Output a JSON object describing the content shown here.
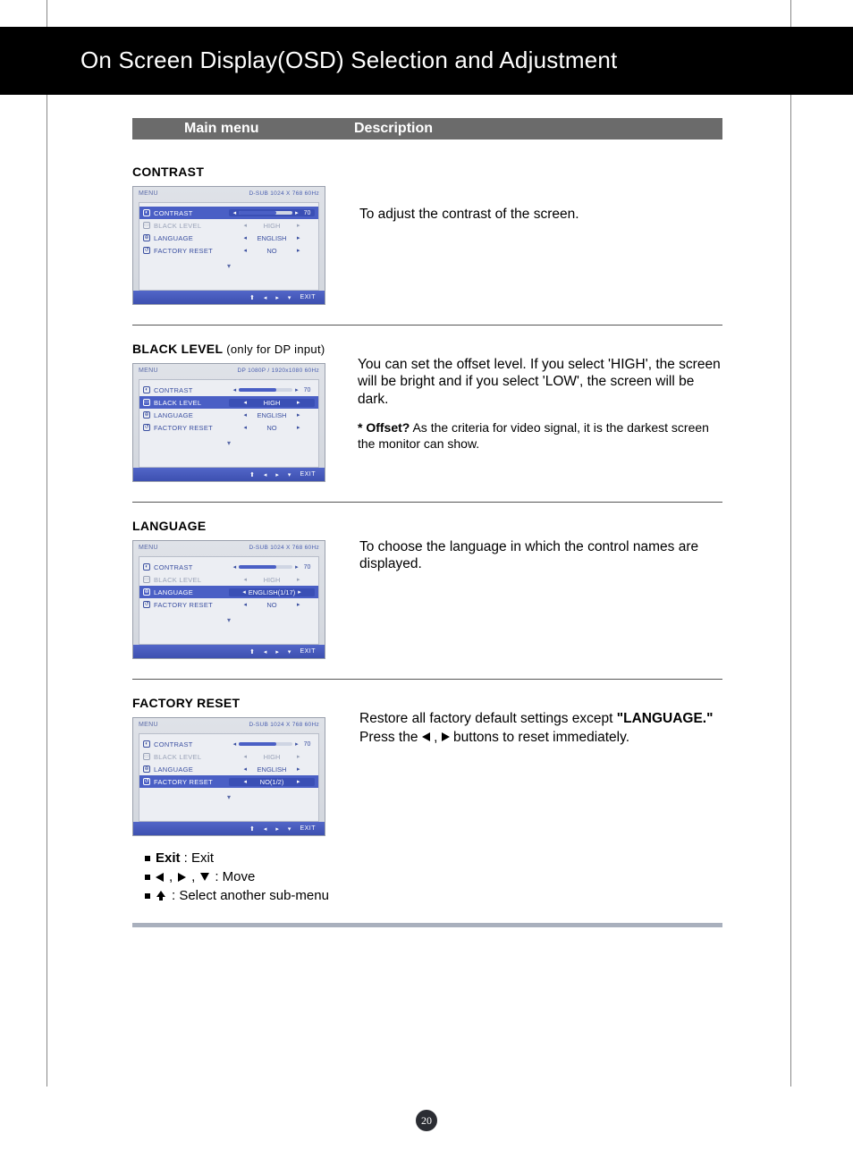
{
  "page": {
    "title": "On Screen Display(OSD) Selection and Adjustment",
    "columns": {
      "main_menu": "Main menu",
      "description": "Description"
    },
    "number": "20"
  },
  "sections": {
    "contrast": {
      "heading": "CONTRAST",
      "description": "To adjust the contrast of the screen.",
      "osd": {
        "menu_label": "MENU",
        "signal": "D-SUB 1024 X 768 60Hz",
        "rows": {
          "contrast": {
            "label": "CONTRAST",
            "value": "70",
            "selected": true,
            "slider": true
          },
          "black_level": {
            "label": "BLACK LEVEL",
            "value": "HIGH",
            "dim": true
          },
          "language": {
            "label": "LANGUAGE",
            "value": "ENGLISH"
          },
          "factory_reset": {
            "label": "FACTORY RESET",
            "value": "NO"
          }
        },
        "exit": "EXIT"
      }
    },
    "black_level": {
      "heading": "BLACK LEVEL",
      "qualifier": "(only for DP input)",
      "description": "You can set the offset level. If you select 'HIGH', the screen will be bright and if you select 'LOW', the screen will be dark.",
      "offset_label": "* Offset?",
      "offset_text": " As the criteria for video signal, it is the darkest screen the monitor can show.",
      "osd": {
        "menu_label": "MENU",
        "signal": "DP 1080P / 1920x1080 60Hz",
        "rows": {
          "contrast": {
            "label": "CONTRAST",
            "value": "70",
            "slider": true
          },
          "black_level": {
            "label": "BLACK LEVEL",
            "value": "HIGH",
            "selected": true
          },
          "language": {
            "label": "LANGUAGE",
            "value": "ENGLISH"
          },
          "factory_reset": {
            "label": "FACTORY RESET",
            "value": "NO"
          }
        },
        "exit": "EXIT"
      }
    },
    "language": {
      "heading": "LANGUAGE",
      "description": "To choose the language in which the control names are displayed.",
      "osd": {
        "menu_label": "MENU",
        "signal": "D-SUB 1024 X 768 60Hz",
        "rows": {
          "contrast": {
            "label": "CONTRAST",
            "value": "70",
            "slider": true
          },
          "black_level": {
            "label": "BLACK LEVEL",
            "value": "HIGH",
            "dim": true
          },
          "language": {
            "label": "LANGUAGE",
            "value": "ENGLISH(1/17)",
            "selected": true
          },
          "factory_reset": {
            "label": "FACTORY RESET",
            "value": "NO"
          }
        },
        "exit": "EXIT"
      }
    },
    "factory_reset": {
      "heading": "FACTORY RESET",
      "description_1": "Restore all factory default settings except ",
      "description_strong": "\"LANGUAGE.\"",
      "description_2a": "Press the ",
      "description_2b": " buttons to reset immediately.",
      "osd": {
        "menu_label": "MENU",
        "signal": "D-SUB 1024 X 768 60Hz",
        "rows": {
          "contrast": {
            "label": "CONTRAST",
            "value": "70",
            "slider": true
          },
          "black_level": {
            "label": "BLACK LEVEL",
            "value": "HIGH",
            "dim": true
          },
          "language": {
            "label": "LANGUAGE",
            "value": "ENGLISH"
          },
          "factory_reset": {
            "label": "FACTORY RESET",
            "value": "NO(1/2)",
            "selected": true
          }
        },
        "exit": "EXIT"
      }
    }
  },
  "legend": {
    "exit_label": "Exit",
    "exit_desc": " : Exit",
    "move_desc": " : Move",
    "select_desc": " : Select another sub-menu"
  }
}
